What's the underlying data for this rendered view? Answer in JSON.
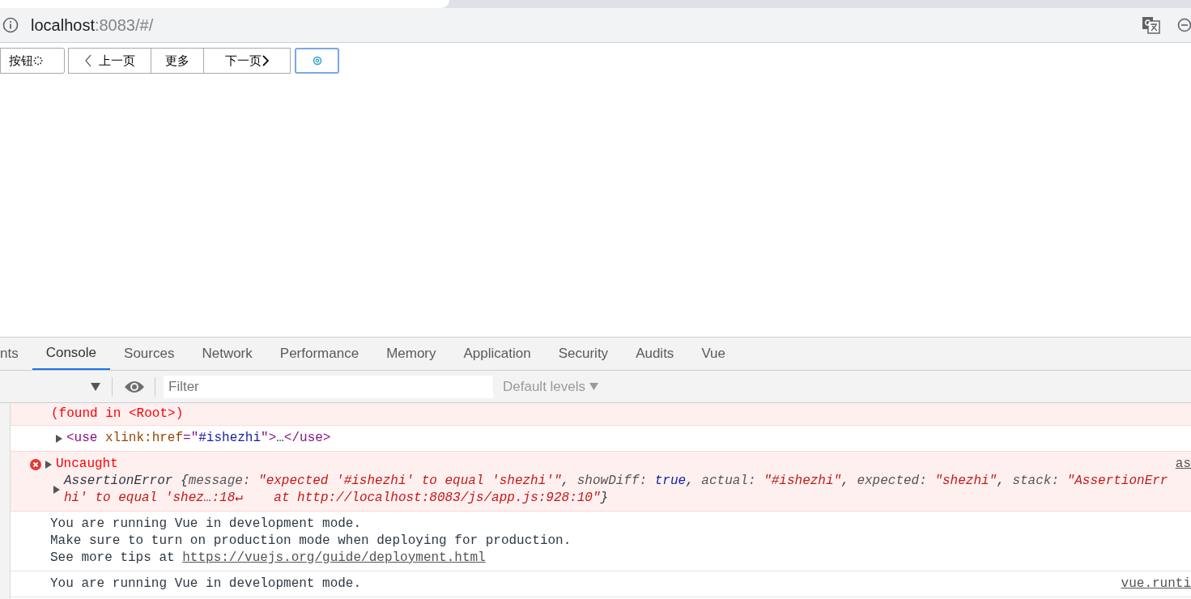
{
  "address_bar": {
    "host": "localhost",
    "rest": ":8083/#/"
  },
  "page": {
    "buttons": [
      {
        "kind": "loading",
        "label": "按钮"
      },
      {
        "kind": "group",
        "items": [
          {
            "label": "上一页"
          },
          {
            "label": "更多"
          },
          {
            "label": "下一页"
          }
        ]
      },
      {
        "kind": "icon",
        "focused": true
      }
    ]
  },
  "devtools": {
    "tabs": [
      {
        "label": "nts",
        "selected": false
      },
      {
        "label": "Console",
        "selected": true
      },
      {
        "label": "Sources",
        "selected": false
      },
      {
        "label": "Network",
        "selected": false
      },
      {
        "label": "Performance",
        "selected": false
      },
      {
        "label": "Memory",
        "selected": false
      },
      {
        "label": "Application",
        "selected": false
      },
      {
        "label": "Security",
        "selected": false
      },
      {
        "label": "Audits",
        "selected": false
      },
      {
        "label": "Vue",
        "selected": false
      }
    ],
    "filter": {
      "placeholder": "Filter"
    },
    "levels": "Default levels",
    "messages": [
      {
        "kind": "error-text",
        "lines": [
          "(found in <Root>)"
        ]
      },
      {
        "kind": "element",
        "parts": [
          {
            "kind": "tag",
            "text": "<use "
          },
          {
            "kind": "attr",
            "text": "xlink:href"
          },
          {
            "kind": "tag",
            "text": "=\""
          },
          {
            "kind": "value",
            "text": "#ishezhi"
          },
          {
            "kind": "tag",
            "text": "\">"
          },
          {
            "kind": "plain",
            "text": "…"
          },
          {
            "kind": "tag",
            "text": "</use>"
          }
        ]
      },
      {
        "kind": "error",
        "title": "Uncaught",
        "source": "as",
        "lines": [
          {
            "parts": [
              {
                "kind": "plain",
                "text": "AssertionError {"
              },
              {
                "kind": "key",
                "text": "message: "
              },
              {
                "kind": "string",
                "text": "\"expected '#ishezhi' to equal 'shezhi'\""
              },
              {
                "kind": "plain",
                "text": ", "
              },
              {
                "kind": "key",
                "text": "showDiff: "
              },
              {
                "kind": "keyword",
                "text": "true"
              },
              {
                "kind": "plain",
                "text": ", "
              },
              {
                "kind": "key",
                "text": "actual: "
              },
              {
                "kind": "string",
                "text": "\"#ishezhi\""
              },
              {
                "kind": "plain",
                "text": ", "
              },
              {
                "kind": "key",
                "text": "expected: "
              },
              {
                "kind": "string",
                "text": "\"shezhi\""
              },
              {
                "kind": "plain",
                "text": ", "
              },
              {
                "kind": "key",
                "text": "stack: "
              },
              {
                "kind": "string",
                "text": "\"AssertionErr"
              }
            ]
          },
          {
            "parts": [
              {
                "kind": "string",
                "text": "hi' to equal 'shez…:18↵    at http://localhost:8083/js/app.js:928:10\""
              },
              {
                "kind": "plain",
                "text": "}"
              }
            ]
          }
        ]
      },
      {
        "kind": "log",
        "lines": [
          "You are running Vue in development mode.",
          "Make sure to turn on production mode when deploying for production."
        ],
        "link_prefix": "See more tips at ",
        "link": "https://vuejs.org/guide/deployment.html"
      },
      {
        "kind": "log",
        "source": "vue.runti",
        "lines": [
          "You are running Vue in development mode."
        ]
      }
    ]
  }
}
